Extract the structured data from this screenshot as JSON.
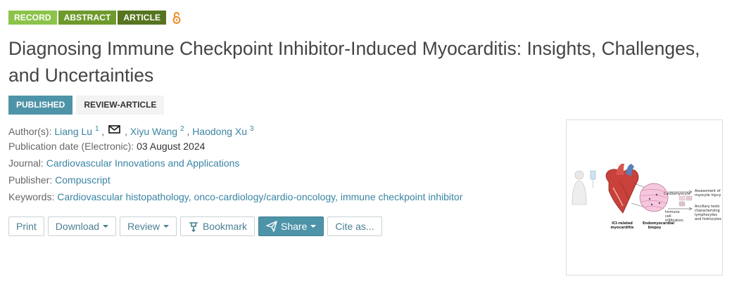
{
  "badges": {
    "record": "RECORD",
    "abstract": "ABSTRACT",
    "article": "ARTICLE",
    "open_access_icon": "open-access-icon"
  },
  "title": "Diagnosing Immune Checkpoint Inhibitor-Induced Myocarditis: Insights, Challenges, and Uncertainties",
  "status": {
    "published": "PUBLISHED",
    "type": "REVIEW-ARTICLE"
  },
  "meta": {
    "authors_label": "Author(s):",
    "authors": [
      {
        "name": "Liang Lu",
        "sup": "1"
      },
      {
        "name": "Xiyu Wang",
        "sup": "2"
      },
      {
        "name": "Haodong Xu",
        "sup": "3"
      }
    ],
    "pubdate_label": "Publication date (Electronic):",
    "pubdate": "03 August 2024",
    "journal_label": "Journal:",
    "journal": "Cardiovascular Innovations and Applications",
    "publisher_label": "Publisher:",
    "publisher": "Compuscript",
    "keywords_label": "Keywords:",
    "keywords": "Cardiovascular histopathology, onco-cardiology/cardio-oncology, immune checkpoint inhibitor"
  },
  "actions": {
    "print": "Print",
    "download": "Download",
    "review": "Review",
    "bookmark": "Bookmark",
    "share": "Share",
    "cite": "Cite as..."
  },
  "figure": {
    "labels": {
      "cardiomyocyte": "Cardiomyocyte",
      "immune": "Immune cell infiltration",
      "ici": "ICI-related myocarditis",
      "biopsy": "Endomyocardial biopsy",
      "assess": "Assessment of myocyte injury",
      "ancillary": "Ancillary tests characterizing lymphocytes and histiocytes"
    }
  },
  "colors": {
    "accent": "#4e94a8",
    "link": "#3a84a3",
    "record": "#8cc34a",
    "abstract": "#6e9a2c",
    "article": "#56741f",
    "oa_orange": "#f08a24"
  }
}
